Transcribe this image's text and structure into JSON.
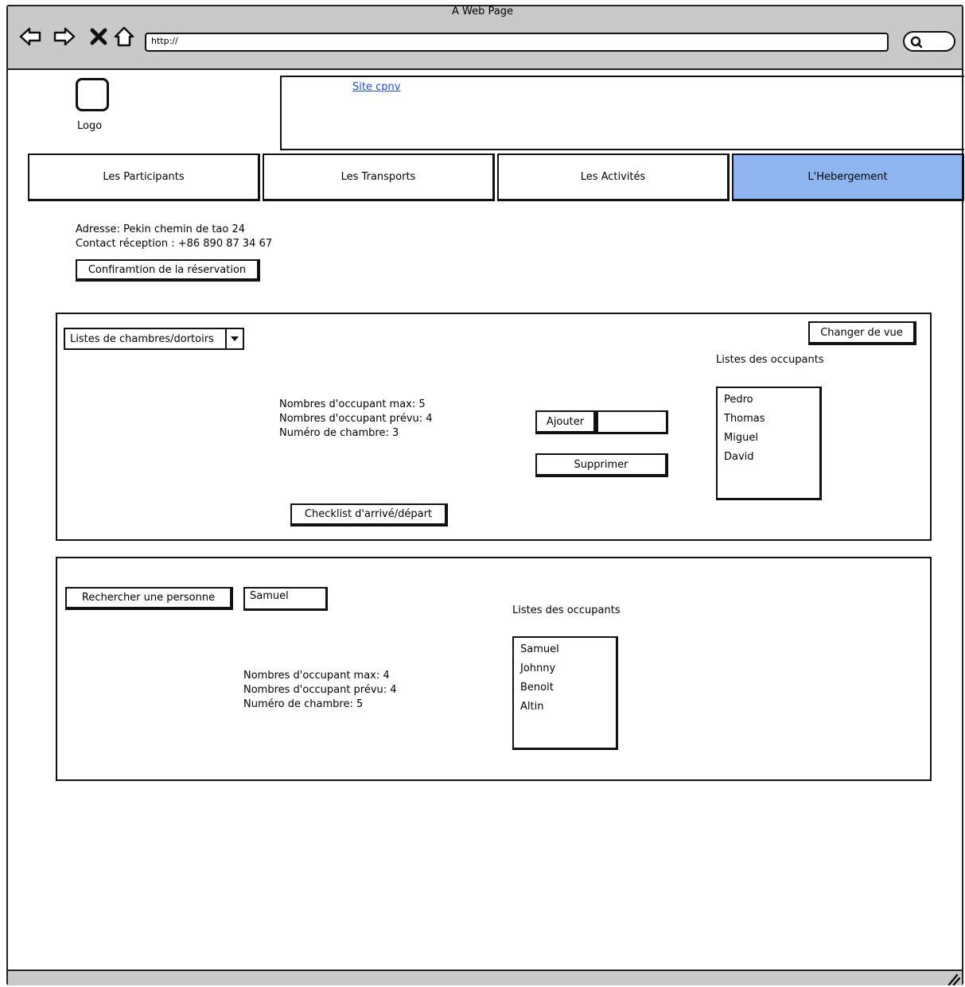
{
  "window": {
    "title": "A Web Page",
    "url": "http://"
  },
  "header": {
    "logo_label": "Logo",
    "site_link": "Site cpnv"
  },
  "tabs": [
    {
      "label": "Les Participants"
    },
    {
      "label": "Les Transports"
    },
    {
      "label": "Les Activités"
    },
    {
      "label": "L'Hebergement"
    }
  ],
  "hotel": {
    "address": "Adresse: Pekin chemin de tao 24",
    "contact": "Contact réception : +86 890 87 34 67",
    "confirm_button": "Confiramtion de la réservation"
  },
  "rooms_panel": {
    "dropdown": "Listes de chambres/dortoirs",
    "change_view_button": "Changer de vue",
    "occupants_title": "Listes des occupants",
    "max_occupants": "Nombres d'occupant max: 5",
    "planned_occupants": "Nombres d'occupant prévu: 4",
    "room_number": "Numéro de chambre: 3",
    "add_button": "Ajouter",
    "add_input_value": "",
    "remove_button": "Supprimer",
    "checklist_button": "Checklist d'arrivé/départ",
    "occupants": [
      "Pedro",
      "Thomas",
      "Miguel",
      "David"
    ]
  },
  "search_panel": {
    "search_button": "Rechercher une personne",
    "search_value": "Samuel",
    "occupants_title": "Listes des occupants",
    "max_occupants": "Nombres d'occupant max: 4",
    "planned_occupants": "Nombres d'occupant prévu: 4",
    "room_number": "Numéro de chambre: 5",
    "occupants": [
      "Samuel",
      "Johnny",
      "Benoit",
      "Altin"
    ]
  },
  "accent_color": "#8eb5ef"
}
